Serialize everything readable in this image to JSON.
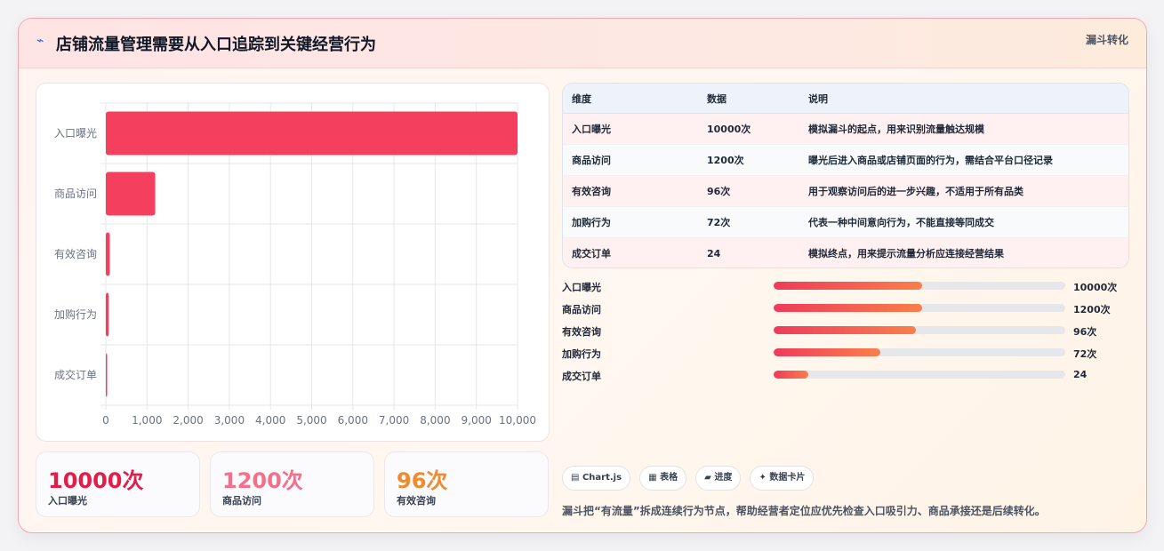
{
  "header": {
    "icon": "lightning-icon",
    "title": "店铺流量管理需要从入口追踪到关键经营行为",
    "badge": "漏斗转化"
  },
  "chart_data": {
    "type": "bar",
    "orientation": "horizontal",
    "categories": [
      "入口曝光",
      "商品访问",
      "有效咨询",
      "加购行为",
      "成交订单"
    ],
    "values": [
      10000,
      1200,
      96,
      72,
      24
    ],
    "xlim": [
      0,
      10000
    ],
    "xticks": [
      "0",
      "1,000",
      "2,000",
      "3,000",
      "4,000",
      "5,000",
      "6,000",
      "7,000",
      "8,000",
      "9,000",
      "10,000"
    ],
    "grid": true,
    "bar_color": "#f43f5e"
  },
  "kpis": [
    {
      "value": "10000次",
      "label": "入口曝光",
      "color": "#e11d48"
    },
    {
      "value": "1200次",
      "label": "商品访问",
      "color": "#f2708a"
    },
    {
      "value": "96次",
      "label": "有效咨询",
      "color": "#f08a2f"
    }
  ],
  "table": {
    "headers": [
      "维度",
      "数据",
      "说明"
    ],
    "rows": [
      [
        "入口曝光",
        "10000次",
        "模拟漏斗的起点，用来识别流量触达规模"
      ],
      [
        "商品访问",
        "1200次",
        "曝光后进入商品或店铺页面的行为，需结合平台口径记录"
      ],
      [
        "有效咨询",
        "96次",
        "用于观察访问后的进一步兴趣，不适用于所有品类"
      ],
      [
        "加购行为",
        "72次",
        "代表一种中间意向行为，不能直接等同成交"
      ],
      [
        "成交订单",
        "24",
        "模拟终点，用来提示流量分析应连接经营结果"
      ]
    ]
  },
  "progress": [
    {
      "label": "入口曝光",
      "value": "10000次",
      "fraction": 0.508
    },
    {
      "label": "商品访问",
      "value": "1200次",
      "fraction": 0.508
    },
    {
      "label": "有效咨询",
      "value": "96次",
      "fraction": 0.487
    },
    {
      "label": "加购行为",
      "value": "72次",
      "fraction": 0.365
    },
    {
      "label": "成交订单",
      "value": "24",
      "fraction": 0.12
    }
  ],
  "chips": [
    {
      "icon": "chart-icon",
      "glyph": "▤",
      "label": "Chart.js"
    },
    {
      "icon": "table-icon",
      "glyph": "▦",
      "label": "表格"
    },
    {
      "icon": "progress-icon",
      "glyph": "▰",
      "label": "进度"
    },
    {
      "icon": "sparkle-icon",
      "glyph": "✦",
      "label": "数据卡片"
    }
  ],
  "footer": {
    "note": "漏斗把“有流量”拆成连续行为节点，帮助经营者定位应优先检查入口吸引力、商品承接还是后续转化。"
  }
}
